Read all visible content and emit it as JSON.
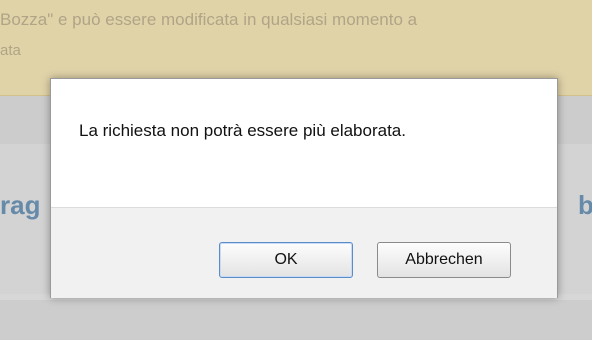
{
  "background": {
    "notice_line1": "Bozza\" e può essere modificata in qualsiasi momento a",
    "notice_line2": "ata",
    "heading_left": "rag",
    "heading_right": "bb"
  },
  "dialog": {
    "message": "La richiesta non potrà essere più elaborata.",
    "ok_label": "OK",
    "cancel_label": "Abbrechen"
  },
  "colors": {
    "notice_bg": "#f7e3a8",
    "heading": "#4d7ea9",
    "ok_border": "#5b8bc9"
  }
}
